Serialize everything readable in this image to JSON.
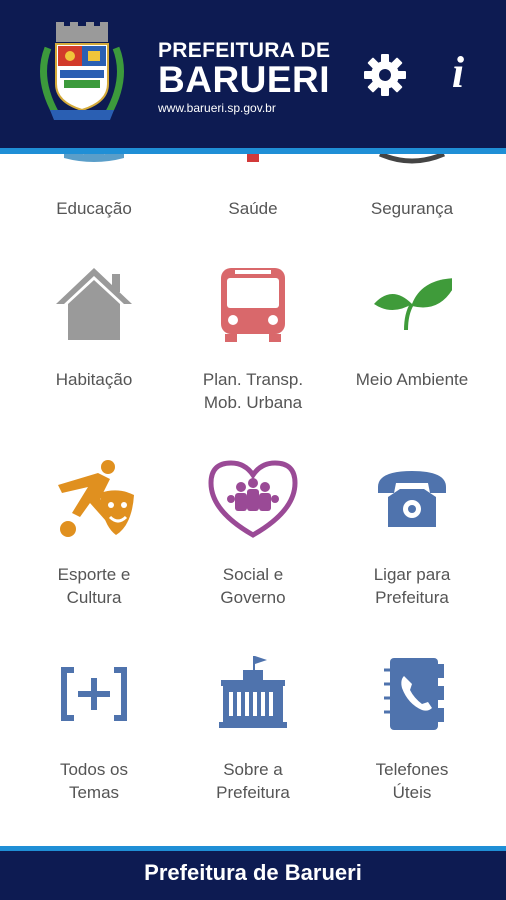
{
  "header": {
    "brand_line1": "PREFEITURA DE",
    "brand_line2": "BARUERI",
    "url": "www.barueri.sp.gov.br",
    "info_label": "i"
  },
  "tiles_partial": [
    {
      "label": "Educação"
    },
    {
      "label": "Saúde"
    },
    {
      "label": "Segurança"
    }
  ],
  "tiles": [
    {
      "line1": "Habitação",
      "line2": ""
    },
    {
      "line1": "Plan. Transp.",
      "line2": "Mob. Urbana"
    },
    {
      "line1": "Meio Ambiente",
      "line2": ""
    },
    {
      "line1": "Esporte e",
      "line2": "Cultura"
    },
    {
      "line1": "Social e",
      "line2": "Governo"
    },
    {
      "line1": "Ligar para",
      "line2": "Prefeitura"
    },
    {
      "line1": "Todos os",
      "line2": "Temas"
    },
    {
      "line1": "Sobre a",
      "line2": "Prefeitura"
    },
    {
      "line1": "Telefones",
      "line2": "Úteis"
    }
  ],
  "footer": {
    "title": "Prefeitura de Barueri"
  },
  "colors": {
    "header_bg": "#0d1b52",
    "stripe": "#1f8fd6",
    "label": "#555555",
    "house": "#9a9a9a",
    "bus": "#d9686b",
    "leaf": "#3f9b3a",
    "sport": "#e0901f",
    "social": "#9a4a96",
    "blue_icon": "#4f73ad"
  }
}
